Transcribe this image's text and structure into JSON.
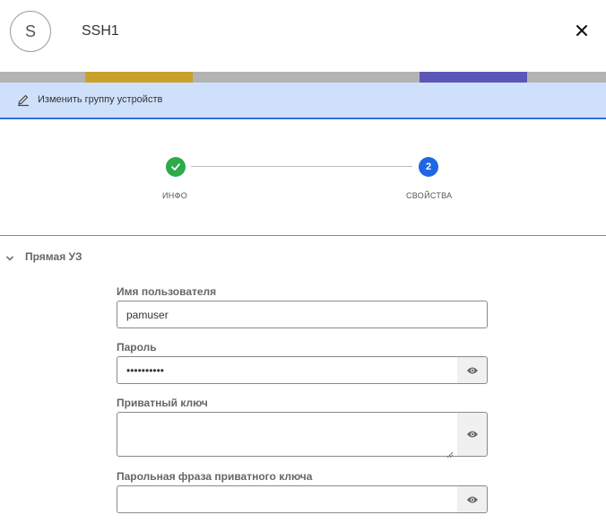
{
  "header": {
    "avatar_letter": "S",
    "title": "SSH1",
    "close_icon": "close-icon"
  },
  "edit_bar": {
    "icon": "pencil-icon",
    "label": "Изменить группу устройств"
  },
  "stepper": {
    "steps": [
      {
        "label": "ИНФО",
        "state": "completed",
        "icon": "check-icon"
      },
      {
        "label": "СВОЙСТВА",
        "number": "2",
        "state": "active"
      }
    ],
    "colors": {
      "completed": "#2eaa4a",
      "active": "#1f66e5"
    }
  },
  "section": {
    "label": "Прямая УЗ",
    "icon": "chevron-down-icon"
  },
  "fields": {
    "username": {
      "label": "Имя пользователя",
      "value": "pamuser"
    },
    "password": {
      "label": "Пароль",
      "value": "••••••••••"
    },
    "private_key": {
      "label": "Приватный ключ",
      "value": ""
    },
    "passphrase": {
      "label": "Парольная фраза приватного ключа",
      "value": ""
    }
  }
}
